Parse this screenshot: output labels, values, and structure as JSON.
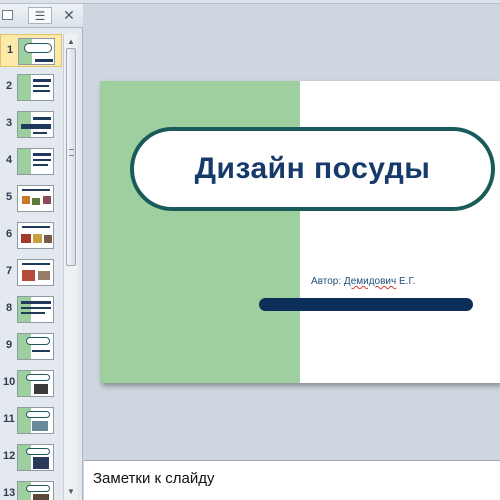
{
  "notes_pane": {
    "placeholder": "Заметки к слайду"
  },
  "slide": {
    "title": "Дизайн посуды",
    "author_prefix": "Автор: ",
    "author_name": "Демидович",
    "author_suffix": " Е.Г."
  },
  "thumbnails": [
    {
      "number": "1",
      "selected": true
    },
    {
      "number": "2"
    },
    {
      "number": "3"
    },
    {
      "number": "4"
    },
    {
      "number": "5"
    },
    {
      "number": "6"
    },
    {
      "number": "7"
    },
    {
      "number": "8"
    },
    {
      "number": "9"
    },
    {
      "number": "10"
    },
    {
      "number": "11"
    },
    {
      "number": "12"
    },
    {
      "number": "13"
    }
  ],
  "colors": {
    "slide_green": "#9dcf9f",
    "title_text": "#163a6a",
    "title_border": "#1a5a59",
    "accent_bar": "#0b2f59",
    "selection": "#fde9a8"
  },
  "icons": {
    "slides_tab": "slides-tab-icon",
    "outline_tab": "outline-tab-icon",
    "close": "close-icon"
  }
}
